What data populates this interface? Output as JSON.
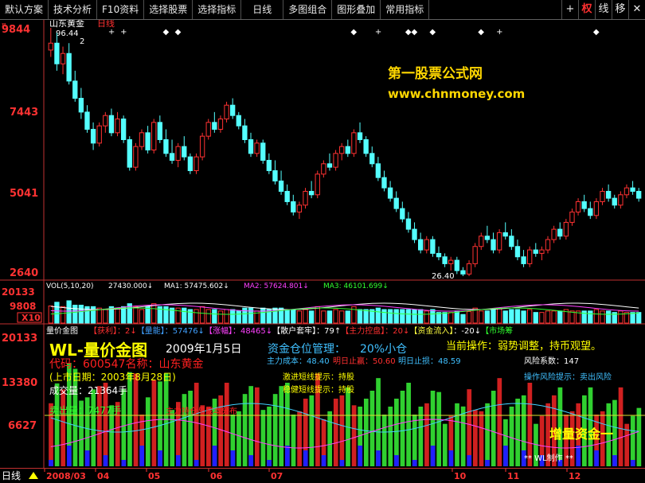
{
  "toolbar": {
    "buttons": [
      "默认方案",
      "技术分析",
      "F10资料",
      "选择股票",
      "选择指标",
      "日线",
      "多图组合",
      "图形叠加",
      "常用指标"
    ],
    "icons": [
      {
        "name": "plus-icon",
        "glyph": "+"
      },
      {
        "name": "weight-toggle",
        "glyph": "权",
        "active": true
      },
      {
        "name": "line-toggle",
        "glyph": "线"
      },
      {
        "name": "move-toggle",
        "glyph": "移"
      },
      {
        "name": "close-icon",
        "glyph": "✕"
      }
    ]
  },
  "price_panel": {
    "stock_name": "山东黄金",
    "period": "日线",
    "axis_labels": [
      "9844",
      "7443",
      "5041",
      "2640"
    ],
    "high_label": "96.44",
    "low_label": "26.40",
    "marker_2": "2"
  },
  "watermark": {
    "line1": "第一股票公式网",
    "line2": "www.chnmoney.com"
  },
  "vol_panel": {
    "header": "VOL(5,10,20)",
    "vol_value": "27430.000↓",
    "ma1": "MA1: 57475.602↓",
    "ma2": "MA2: 57624.801↓",
    "ma3": "MA3: 46101.699↓",
    "axis_labels": [
      "20133",
      "9808",
      "X10"
    ]
  },
  "ind_panel": {
    "title": "量价金图",
    "tags": [
      {
        "text": "【获利】",
        "color": "#ff3030"
      },
      {
        "text": "：2↓",
        "color": "#ff3030"
      },
      {
        "text": "【量能】",
        "color": "#40a0ff"
      },
      {
        "text": "：57476↓",
        "color": "#40a0ff"
      },
      {
        "text": "【涨幅】",
        "color": "#ff40ff"
      },
      {
        "text": "：48465↓",
        "color": "#ff40ff"
      },
      {
        "text": "【散户套牢】",
        "color": "#ffffff"
      },
      {
        "text": "：79↑",
        "color": "#ffffff"
      },
      {
        "text": "【主力控盘】",
        "color": "#ff3030"
      },
      {
        "text": "：20↓",
        "color": "#ff3030"
      },
      {
        "text": "【资金流入】",
        "color": "#ffff40"
      },
      {
        "text": "：-20↓",
        "color": "#ffffff"
      },
      {
        "text": "【市场筹",
        "color": "#30ff30"
      }
    ],
    "axis_labels": [
      "20133",
      "13380",
      "6627"
    ]
  },
  "overlay": {
    "wl_title": "WL-量价金图",
    "date": "2009年1月5日",
    "fund_label": "资金仓位管理：",
    "fund_value": "20%小仓",
    "operation": "当前操作：弱势调整，持币观望。",
    "cost": "主力成本：48.40",
    "stop_profit": "明日止赢：50.60",
    "stop_loss": "明日止损：48.59",
    "risk": "风险系数：147",
    "code": "代码：600547名称：山东黄金",
    "listing_date": "(上市日期：2003年8月28日)",
    "volume": "成交量：21364手",
    "sell": "卖出量：7477手",
    "aggressive": "激进短线提示：持股",
    "steady": "稳健短线提示：持股",
    "risk_tip": "操作风险提示：卖出风险",
    "increase": "增量资金一",
    "author": "** WL制作 **",
    "red_note": "主力持仓与成本分布"
  },
  "bottom": {
    "period_label": "日线",
    "date_labels": [
      "2008/03",
      "04",
      "05",
      "06",
      "07",
      "10",
      "11",
      "12"
    ]
  },
  "colors": {
    "up": "#ff3232",
    "down": "#54ffff",
    "grid": "#8b0000",
    "axis": "#ff3232",
    "yellow": "#ffff00",
    "green_bar": "#30d030",
    "red_bar": "#d02020",
    "blue_bar": "#2020ff"
  },
  "chart_data": [
    {
      "type": "candlestick",
      "title": "山东黄金 日线",
      "ylim": [
        2640,
        9844
      ],
      "price_high": 96.44,
      "price_low": 26.4,
      "ohlc": [
        [
          9200,
          9844,
          9000,
          9400
        ],
        [
          9400,
          9700,
          8600,
          8800
        ],
        [
          8800,
          9300,
          8500,
          9100
        ],
        [
          9100,
          9400,
          8200,
          8300
        ],
        [
          8300,
          8600,
          7700,
          7800
        ],
        [
          7800,
          8100,
          7200,
          7400
        ],
        [
          7400,
          7600,
          6800,
          6900
        ],
        [
          6900,
          7100,
          6300,
          6500
        ],
        [
          6500,
          7100,
          6400,
          7000
        ],
        [
          7000,
          7400,
          6800,
          7300
        ],
        [
          7300,
          7500,
          6700,
          6800
        ],
        [
          6800,
          7400,
          6700,
          7200
        ],
        [
          7200,
          7300,
          6500,
          6600
        ],
        [
          6600,
          6700,
          5700,
          5800
        ],
        [
          5800,
          6500,
          5700,
          6400
        ],
        [
          6400,
          6900,
          6300,
          6800
        ],
        [
          6800,
          7000,
          6200,
          6300
        ],
        [
          6300,
          7200,
          6200,
          7100
        ],
        [
          7100,
          7300,
          6500,
          6600
        ],
        [
          6600,
          6900,
          6100,
          6200
        ],
        [
          6200,
          6600,
          5900,
          6000
        ],
        [
          6000,
          6500,
          5800,
          6400
        ],
        [
          6400,
          6700,
          6000,
          6100
        ],
        [
          6100,
          6200,
          5600,
          5700
        ],
        [
          5700,
          6200,
          5600,
          6100
        ],
        [
          6100,
          6800,
          6000,
          6700
        ],
        [
          6700,
          7200,
          6600,
          7100
        ],
        [
          7100,
          7400,
          6800,
          6900
        ],
        [
          6900,
          7300,
          6800,
          7200
        ],
        [
          7200,
          7700,
          7100,
          7600
        ],
        [
          7600,
          7800,
          7200,
          7300
        ],
        [
          7300,
          7400,
          6900,
          7000
        ],
        [
          7000,
          7200,
          6500,
          6600
        ],
        [
          6600,
          6800,
          6100,
          6200
        ],
        [
          6200,
          6600,
          6100,
          6500
        ],
        [
          6500,
          6600,
          5900,
          6000
        ],
        [
          6000,
          6200,
          5600,
          5700
        ],
        [
          5700,
          6000,
          5300,
          5400
        ],
        [
          5400,
          5700,
          5000,
          5100
        ],
        [
          5100,
          5300,
          4700,
          4800
        ],
        [
          4800,
          5000,
          4400,
          4500
        ],
        [
          4500,
          4800,
          4300,
          4700
        ],
        [
          4700,
          5200,
          4600,
          5100
        ],
        [
          5100,
          5400,
          4900,
          5000
        ],
        [
          5000,
          5700,
          4900,
          5600
        ],
        [
          5600,
          6000,
          5500,
          5900
        ],
        [
          5900,
          6200,
          5700,
          5800
        ],
        [
          5800,
          6300,
          5700,
          6200
        ],
        [
          6200,
          6500,
          6000,
          6400
        ],
        [
          6400,
          6600,
          6100,
          6200
        ],
        [
          6200,
          6900,
          6100,
          6800
        ],
        [
          6800,
          7100,
          6500,
          6600
        ],
        [
          6600,
          6700,
          6100,
          6200
        ],
        [
          6200,
          6400,
          5800,
          5900
        ],
        [
          5900,
          6100,
          5400,
          5500
        ],
        [
          5500,
          5700,
          5100,
          5200
        ],
        [
          5200,
          5400,
          4800,
          4900
        ],
        [
          4900,
          5100,
          4500,
          4600
        ],
        [
          4600,
          4800,
          4200,
          4300
        ],
        [
          4300,
          4500,
          3900,
          4000
        ],
        [
          4000,
          4200,
          3600,
          3700
        ],
        [
          3700,
          3900,
          3300,
          3400
        ],
        [
          3400,
          3800,
          3300,
          3700
        ],
        [
          3700,
          3800,
          3200,
          3300
        ],
        [
          3300,
          3500,
          3100,
          3200
        ],
        [
          3200,
          3300,
          2900,
          3000
        ],
        [
          3000,
          3200,
          2800,
          3100
        ],
        [
          3100,
          3200,
          2700,
          2800
        ],
        [
          2800,
          2900,
          2640,
          2700
        ],
        [
          2700,
          3100,
          2640,
          3000
        ],
        [
          3000,
          3600,
          2900,
          3500
        ],
        [
          3500,
          3900,
          3400,
          3800
        ],
        [
          3800,
          4100,
          3600,
          3700
        ],
        [
          3700,
          3900,
          3300,
          3400
        ],
        [
          3400,
          4000,
          3300,
          3900
        ],
        [
          3900,
          4200,
          3700,
          3800
        ],
        [
          3800,
          4000,
          3400,
          3500
        ],
        [
          3500,
          3700,
          3100,
          3200
        ],
        [
          3200,
          3400,
          2900,
          3000
        ],
        [
          3000,
          3500,
          2900,
          3400
        ],
        [
          3400,
          3600,
          3200,
          3300
        ],
        [
          3300,
          3500,
          3100,
          3400
        ],
        [
          3400,
          3800,
          3300,
          3700
        ],
        [
          3700,
          4100,
          3600,
          4000
        ],
        [
          4000,
          4200,
          3700,
          3800
        ],
        [
          3800,
          4300,
          3700,
          4200
        ],
        [
          4200,
          4600,
          4100,
          4500
        ],
        [
          4500,
          4900,
          4400,
          4800
        ],
        [
          4800,
          5000,
          4500,
          4600
        ],
        [
          4600,
          4800,
          4300,
          4400
        ],
        [
          4400,
          4900,
          4300,
          4800
        ],
        [
          4800,
          5200,
          4700,
          5100
        ],
        [
          5100,
          5300,
          4800,
          4900
        ],
        [
          4900,
          5000,
          4600,
          4700
        ],
        [
          4700,
          5100,
          4600,
          5000
        ],
        [
          5000,
          5300,
          4900,
          5200
        ],
        [
          5200,
          5400,
          5000,
          5100
        ],
        [
          5100,
          5200,
          4800,
          4900
        ]
      ]
    },
    {
      "type": "bar",
      "title": "VOL(5,10,20)",
      "series": [
        {
          "name": "VOL",
          "values": [
            27430
          ]
        },
        {
          "name": "MA1",
          "values": [
            57475.602
          ]
        },
        {
          "name": "MA2",
          "values": [
            57624.801
          ]
        },
        {
          "name": "MA3",
          "values": [
            46101.699
          ]
        }
      ]
    }
  ]
}
